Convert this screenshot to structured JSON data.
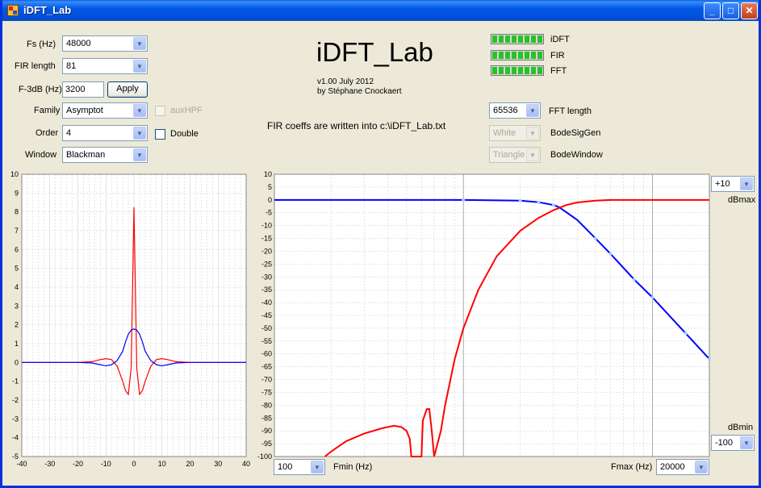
{
  "window": {
    "title": "iDFT_Lab",
    "icon": "app-icon"
  },
  "controls": {
    "fs_label": "Fs (Hz)",
    "fs_value": "48000",
    "fir_label": "FIR length",
    "fir_value": "81",
    "f3db_label": "F-3dB (Hz)",
    "f3db_value": "3200",
    "apply_label": "Apply",
    "family_label": "Family",
    "family_value": "Asymptot",
    "auxhpf_label": "auxHPF",
    "auxhpf_checked": false,
    "order_label": "Order",
    "order_value": "4",
    "double_label": "Double",
    "double_checked": false,
    "window_label": "Window",
    "window_value": "Blackman"
  },
  "header": {
    "app_name": "iDFT_Lab",
    "version": "v1.00 July 2012",
    "author": "by Stéphane Cnockaert",
    "message": "FIR coeffs are written into c:\\iDFT_Lab.txt"
  },
  "meters": [
    {
      "label": "iDFT",
      "level": 1.0
    },
    {
      "label": "FIR",
      "level": 1.0
    },
    {
      "label": "FFT",
      "level": 1.0
    }
  ],
  "fft": {
    "length_value": "65536",
    "length_label": "FFT length",
    "siggen_value": "White",
    "siggen_label": "BodeSigGen",
    "window_value": "Triangle",
    "window_label": "BodeWindow"
  },
  "bode_controls": {
    "dbmax_value": "+10",
    "dbmax_label": "dBmax",
    "dbmin_label": "dBmin",
    "dbmin_value": "-100",
    "fmin_value": "100",
    "fmin_label": "Fmin (Hz)",
    "fmax_label": "Fmax (Hz)",
    "fmax_value": "20000"
  },
  "colors": {
    "red": "#ff0000",
    "blue": "#0000ff",
    "lightblue": "#9fd0ff",
    "grid": "#c8c8c8"
  },
  "chart_data": [
    {
      "type": "line",
      "title": "",
      "xlim": [
        -40,
        40
      ],
      "ylim": [
        -5,
        10
      ],
      "x_ticks": [
        "-40",
        "-30",
        "-20",
        "-10",
        "0",
        "10",
        "20",
        "30",
        "40"
      ],
      "y_ticks": [
        "10",
        "9",
        "8",
        "7",
        "6",
        "5",
        "4",
        "3",
        "2",
        "1",
        "0",
        "-1",
        "-2",
        "-3",
        "-4",
        "-5"
      ],
      "series": [
        {
          "color": "red",
          "x": [
            -40,
            -20,
            -15,
            -12,
            -10,
            -8,
            -6,
            -4,
            -3,
            -2,
            -1,
            0,
            1,
            2,
            3,
            4,
            6,
            8,
            10,
            12,
            15,
            20,
            40
          ],
          "y": [
            0,
            0,
            0.04,
            0.15,
            0.2,
            0.15,
            -0.2,
            -1.0,
            -1.5,
            -1.7,
            -0.3,
            8.25,
            -0.3,
            -1.7,
            -1.5,
            -1.0,
            -0.2,
            0.15,
            0.2,
            0.15,
            0.04,
            0,
            0
          ]
        },
        {
          "color": "blue",
          "x": [
            -40,
            -20,
            -15,
            -12,
            -10,
            -8,
            -6,
            -4,
            -3,
            -2,
            -1,
            0,
            1,
            2,
            3,
            4,
            6,
            8,
            10,
            12,
            15,
            20,
            40
          ],
          "y": [
            0,
            0,
            -0.03,
            -0.12,
            -0.18,
            -0.12,
            0.1,
            0.6,
            1.1,
            1.5,
            1.72,
            1.78,
            1.72,
            1.5,
            1.1,
            0.6,
            0.1,
            -0.12,
            -0.18,
            -0.12,
            -0.03,
            0,
            0
          ]
        }
      ]
    },
    {
      "type": "line",
      "title": "",
      "xscale": "log",
      "xlim": [
        100,
        20000
      ],
      "ylim": [
        -100,
        10
      ],
      "y_ticks": [
        "10",
        "5",
        "0",
        "-5",
        "-10",
        "-15",
        "-20",
        "-25",
        "-30",
        "-35",
        "-40",
        "-45",
        "-50",
        "-55",
        "-60",
        "-65",
        "-70",
        "-75",
        "-80",
        "-85",
        "-90",
        "-95",
        "-100"
      ],
      "series": [
        {
          "color": "blue",
          "x": [
            100,
            1000,
            2000,
            2500,
            3000,
            3200,
            3500,
            4000,
            5000,
            6000,
            8000,
            10000,
            15000,
            20000
          ],
          "y": [
            0,
            0,
            -0.3,
            -0.9,
            -2,
            -2.8,
            -4.8,
            -7.8,
            -15,
            -21,
            -31,
            -38,
            -52,
            -62
          ]
        },
        {
          "color": "red",
          "x": [
            185,
            200,
            240,
            300,
            370,
            430,
            470,
            500,
            520,
            530,
            600,
            610,
            640,
            660,
            680,
            700,
            760,
            800,
            900,
            1000,
            1200,
            1500,
            2000,
            2500,
            3000,
            3500,
            4000,
            5000,
            6000,
            8000,
            10000,
            20000
          ],
          "y": [
            -100,
            -98,
            -94,
            -91,
            -89,
            -88,
            -88.5,
            -90,
            -93,
            -100,
            -100,
            -86,
            -81.5,
            -81.5,
            -90,
            -100,
            -90,
            -80,
            -62,
            -50,
            -35,
            -22,
            -12,
            -7,
            -4,
            -2,
            -1,
            -0.3,
            0,
            0,
            0,
            0
          ]
        }
      ]
    }
  ]
}
